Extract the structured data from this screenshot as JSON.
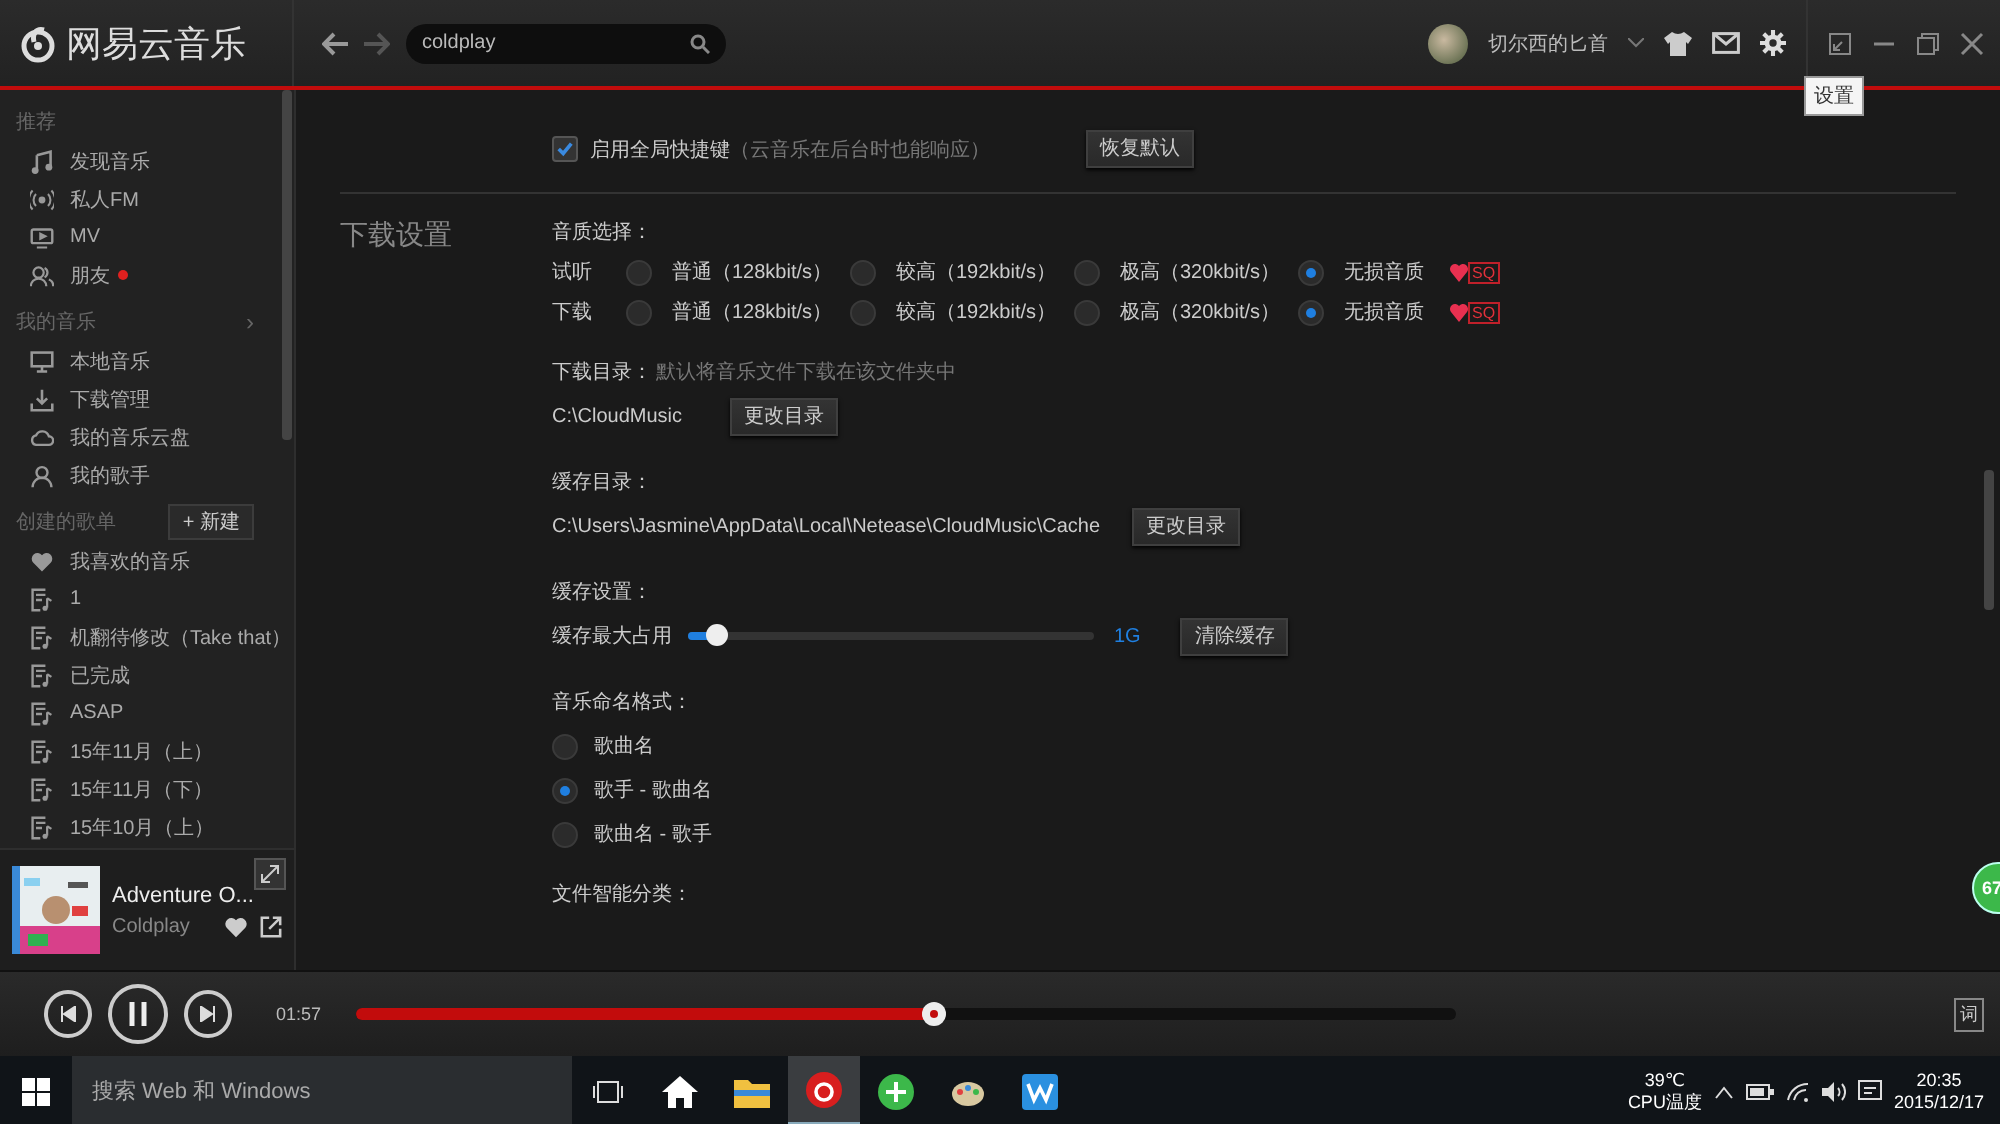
{
  "title_bar": {
    "logo": "网易云音乐",
    "search": {
      "value": "coldplay"
    },
    "user": "切尔西的匕首",
    "tooltip": "设置"
  },
  "sidebar": {
    "sections": [
      {
        "title": "推荐",
        "items": [
          {
            "label": "发现音乐",
            "badge": false
          },
          {
            "label": "私人FM",
            "badge": false
          },
          {
            "label": "MV",
            "badge": false
          },
          {
            "label": "朋友",
            "badge": true
          }
        ]
      },
      {
        "title": "我的音乐",
        "arrow": "›",
        "items": [
          {
            "label": "本地音乐",
            "badge": false
          },
          {
            "label": "下载管理",
            "badge": false
          },
          {
            "label": "我的音乐云盘",
            "badge": false
          },
          {
            "label": "我的歌手",
            "badge": false
          }
        ]
      },
      {
        "title": "创建的歌单",
        "button": "+ 新建",
        "items": [
          {
            "label": "我喜欢的音乐",
            "badge": false
          },
          {
            "label": "1",
            "badge": false
          },
          {
            "label": "机翻待修改（Take that）",
            "badge": false
          },
          {
            "label": "已完成",
            "badge": false
          },
          {
            "label": "ASAP",
            "badge": false
          },
          {
            "label": "15年11月（上）",
            "badge": false
          },
          {
            "label": "15年11月（下）",
            "badge": false
          },
          {
            "label": "15年10月（上）",
            "badge": false
          }
        ]
      }
    ]
  },
  "now_playing": {
    "title": "Adventure O...",
    "artist": "Coldplay"
  },
  "settings": {
    "shortcut": {
      "label": "启用全局快捷键",
      "hint": "（云音乐在后台时也能响应）",
      "checked": true,
      "button": "恢复默认"
    },
    "section_title": "下载设置",
    "quality": {
      "label": "音质选择：",
      "rows": [
        {
          "label": "试听",
          "options": [
            {
              "label": "普通（128kbit/s）",
              "selected": false
            },
            {
              "label": "较高（192kbit/s）",
              "selected": false
            },
            {
              "label": "极高（320kbit/s）",
              "selected": false
            },
            {
              "label": "无损音质",
              "selected": true,
              "badge": "SQ"
            }
          ]
        },
        {
          "label": "下载",
          "options": [
            {
              "label": "普通（128kbit/s）",
              "selected": false
            },
            {
              "label": "较高（192kbit/s）",
              "selected": false
            },
            {
              "label": "极高（320kbit/s）",
              "selected": false
            },
            {
              "label": "无损音质",
              "selected": true,
              "badge": "SQ"
            }
          ]
        }
      ]
    },
    "download_dir": {
      "label": "下载目录：",
      "hint": "默认将音乐文件下载在该文件夹中",
      "path": "C:\\CloudMusic",
      "button": "更改目录"
    },
    "cache_dir": {
      "label": "缓存目录：",
      "path": "C:\\Users\\Jasmine\\AppData\\Local\\Netease\\CloudMusic\\Cache",
      "button": "更改目录"
    },
    "cache": {
      "label": "缓存设置：",
      "slider_label": "缓存最大占用",
      "level": 0.07,
      "reading": "1G",
      "button": "清除缓存"
    },
    "naming": {
      "label": "音乐命名格式：",
      "options": [
        {
          "label": "歌曲名",
          "selected": false
        },
        {
          "label": "歌手 - 歌曲名",
          "selected": true
        },
        {
          "label": "歌曲名 - 歌手",
          "selected": false
        }
      ]
    },
    "file_sort": {
      "label": "文件智能分类："
    }
  },
  "floating_badge": "67",
  "player": {
    "elapsed": "01:57",
    "level": 0.525,
    "lyrics_button": "词"
  },
  "taskbar": {
    "search": {
      "placeholder": "搜索 Web 和 Windows"
    },
    "temperature": "39℃",
    "temperature_label": "CPU温度",
    "time": "20:35",
    "date": "2015/12/17"
  }
}
